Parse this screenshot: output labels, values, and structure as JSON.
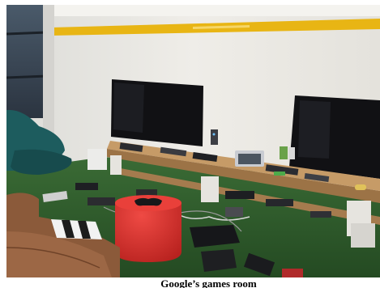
{
  "caption": "Google’s games room",
  "photo": {
    "subject": "games room with two wall-mounted televisions, a long wooden shelf of game consoles, green carpet, a red ottoman and a brown leather couch",
    "colors": {
      "wall": "#e9e7e2",
      "stripe": "#e8b514",
      "carpet": "#2f5a2c",
      "shelf_wood": "#b58a5a",
      "tv_screen": "#111114",
      "ottoman": "#d5302d",
      "couch": "#8b5a3a",
      "beanbag": "#1d5c5e"
    }
  }
}
